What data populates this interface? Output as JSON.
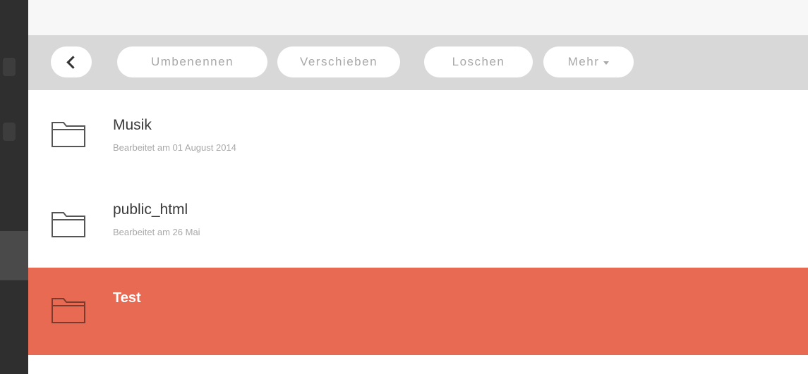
{
  "toolbar": {
    "back_icon": "chevron-left-icon",
    "rename_label": "Umbenennen",
    "move_label": "Verschieben",
    "delete_label": "Loschen",
    "more_label": "Mehr"
  },
  "files": [
    {
      "name": "Musik",
      "modified": "Bearbeitet am 01 August 2014",
      "icon": "folder-icon",
      "selected": false
    },
    {
      "name": "public_html",
      "modified": "Bearbeitet am 26 Mai",
      "icon": "folder-icon",
      "selected": false
    },
    {
      "name": "Test",
      "modified": "",
      "icon": "folder-icon",
      "selected": true
    }
  ],
  "colors": {
    "selected_row": "#e96a52",
    "toolbar_bg": "#d8d8d8",
    "rail_bg": "#2f2f2f"
  }
}
